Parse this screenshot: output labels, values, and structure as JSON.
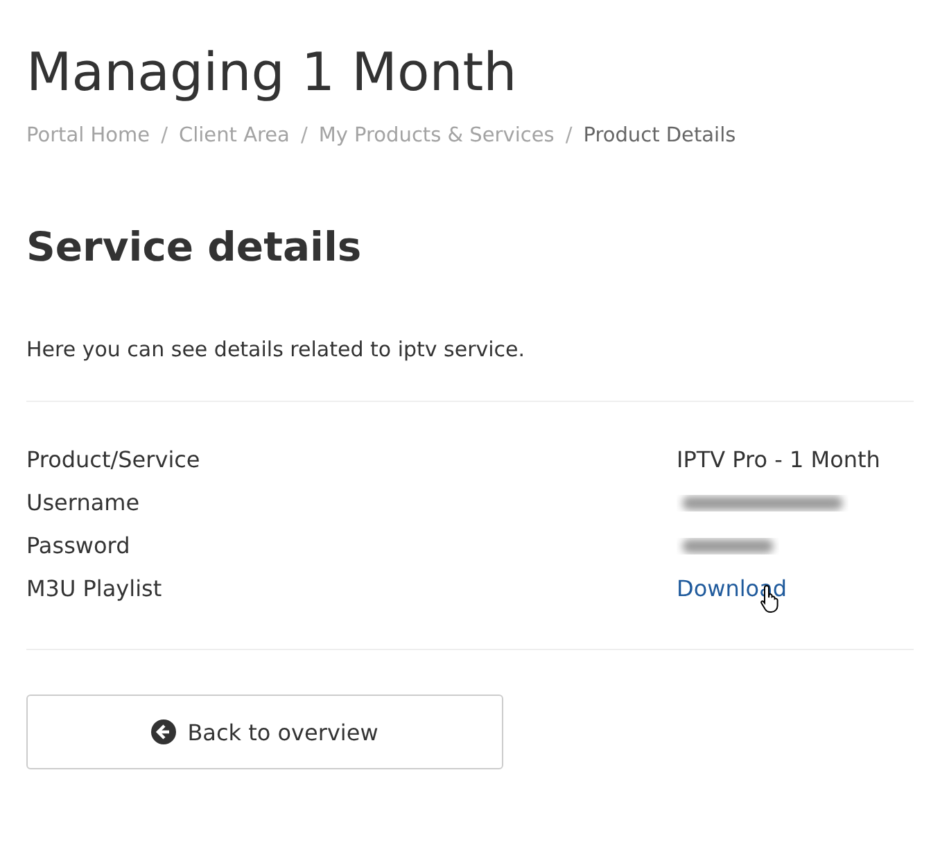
{
  "page_title": "Managing 1 Month",
  "breadcrumb": [
    {
      "label": "Portal Home",
      "current": false
    },
    {
      "label": "Client Area",
      "current": false
    },
    {
      "label": "My Products & Services",
      "current": false
    },
    {
      "label": "Product Details",
      "current": true
    }
  ],
  "breadcrumb_separator": "/",
  "section_title": "Service details",
  "description": "Here you can see details related to iptv service.",
  "details": [
    {
      "label": "Product/Service",
      "kind": "text",
      "value": "IPTV Pro - 1 Month"
    },
    {
      "label": "Username",
      "kind": "blurred"
    },
    {
      "label": "Password",
      "kind": "blurred"
    },
    {
      "label": "M3U Playlist",
      "kind": "link",
      "value": "Download"
    }
  ],
  "back_button": "Back to overview"
}
